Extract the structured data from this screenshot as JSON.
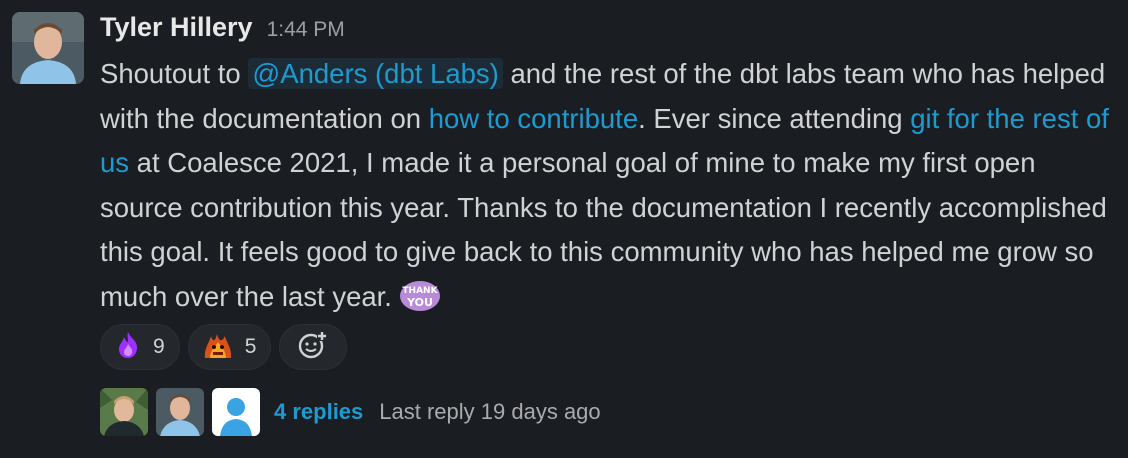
{
  "message": {
    "author": "Tyler Hillery",
    "time": "1:44 PM",
    "parts": {
      "p1": "Shoutout to ",
      "mention": "@Anders (dbt Labs)",
      "p2": " and the rest of the dbt labs team who has helped with the documentation on ",
      "link1": "how to contribute",
      "p3": ".  Ever since attending ",
      "link2": "git for the rest of us",
      "p4": " at Coalesce 2021, I made it a personal goal of mine to make my first open source contribution this year. Thanks to the documentation I recently accomplished this goal. It feels good to give back to this community who has helped me grow so much over the last year."
    },
    "inline_emoji": "thank-you-emoji",
    "inline_emoji_text": "THANK YOU"
  },
  "reactions": [
    {
      "icon": "purple-flame-emoji",
      "count": "9"
    },
    {
      "icon": "fire-creature-emoji",
      "count": "5"
    }
  ],
  "add_reaction_icon": "add-reaction-icon",
  "thread": {
    "replies_label": "4 replies",
    "last_reply": "Last reply 19 days ago"
  },
  "colors": {
    "background": "#1a1d21",
    "link": "#1d9bd1",
    "text": "#d1d2d3"
  }
}
